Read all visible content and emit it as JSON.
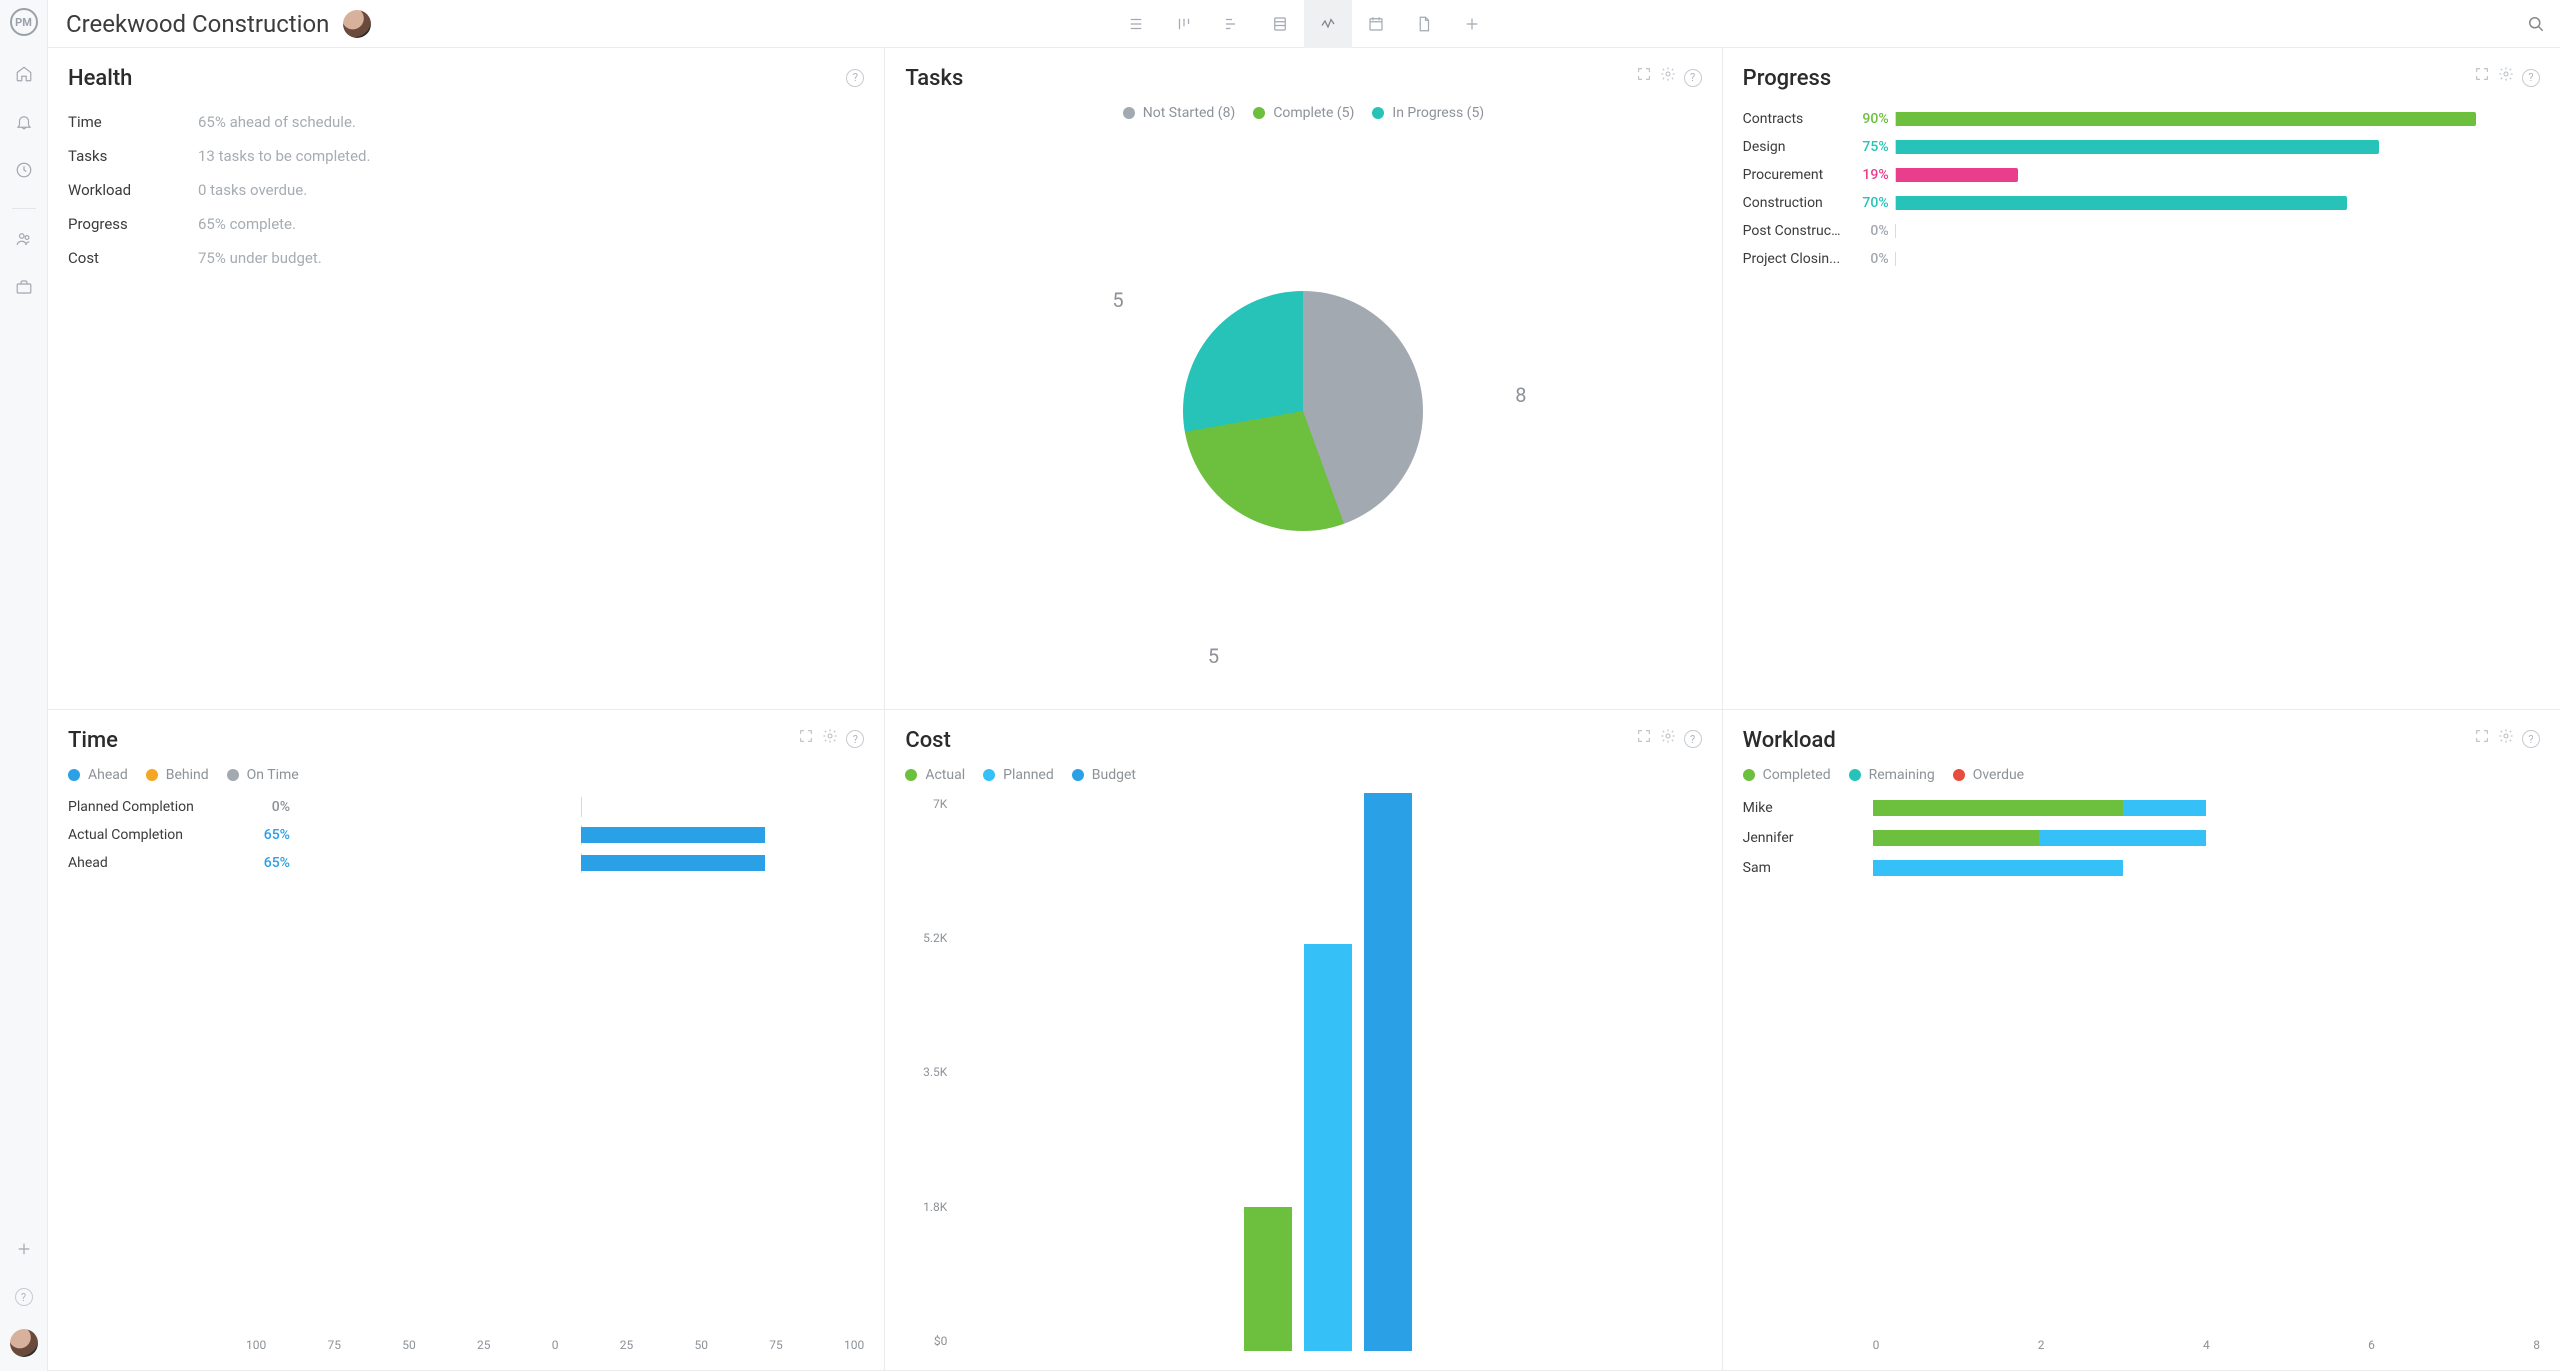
{
  "project_title": "Creekwood Construction",
  "colors": {
    "green": "#6dbf3e",
    "teal": "#27c3b8",
    "blue": "#2aa0e6",
    "lightblue": "#35c0f8",
    "grey": "#a2a9b0",
    "orange": "#f5a623",
    "pink": "#e83e8c",
    "red": "#e74c3c"
  },
  "health": {
    "title": "Health",
    "rows": [
      {
        "label": "Time",
        "value": "65% ahead of schedule."
      },
      {
        "label": "Tasks",
        "value": "13 tasks to be completed."
      },
      {
        "label": "Workload",
        "value": "0 tasks overdue."
      },
      {
        "label": "Progress",
        "value": "65% complete."
      },
      {
        "label": "Cost",
        "value": "75% under budget."
      }
    ]
  },
  "tasks": {
    "title": "Tasks",
    "legend": [
      {
        "label": "Not Started (8)",
        "color": "#a2a9b0"
      },
      {
        "label": "Complete (5)",
        "color": "#6dbf3e"
      },
      {
        "label": "In Progress (5)",
        "color": "#27c3b8"
      }
    ],
    "slices": [
      {
        "label": "8",
        "value": 8,
        "color": "#a2a9b0",
        "lab_pos": "right"
      },
      {
        "label": "5",
        "value": 5,
        "color": "#6dbf3e",
        "lab_pos": "bottom"
      },
      {
        "label": "5",
        "value": 5,
        "color": "#27c3b8",
        "lab_pos": "left"
      }
    ]
  },
  "progress": {
    "title": "Progress",
    "rows": [
      {
        "label": "Contracts",
        "pct": 90,
        "color": "#6dbf3e"
      },
      {
        "label": "Design",
        "pct": 75,
        "color": "#27c3b8"
      },
      {
        "label": "Procurement",
        "pct": 19,
        "color": "#e83e8c"
      },
      {
        "label": "Construction",
        "pct": 70,
        "color": "#27c3b8"
      },
      {
        "label": "Post Construct...",
        "pct": 0,
        "color": "#a2a9b0"
      },
      {
        "label": "Project Closin...",
        "pct": 0,
        "color": "#a2a9b0"
      }
    ]
  },
  "time": {
    "title": "Time",
    "legend": [
      {
        "label": "Ahead",
        "color": "#2aa0e6"
      },
      {
        "label": "Behind",
        "color": "#f5a623"
      },
      {
        "label": "On Time",
        "color": "#a2a9b0"
      }
    ],
    "rows": [
      {
        "label": "Planned Completion",
        "pct": 0
      },
      {
        "label": "Actual Completion",
        "pct": 65
      },
      {
        "label": "Ahead",
        "pct": 65
      }
    ],
    "axis": [
      "100",
      "75",
      "50",
      "25",
      "0",
      "25",
      "50",
      "75",
      "100"
    ]
  },
  "cost": {
    "title": "Cost",
    "legend": [
      {
        "label": "Actual",
        "color": "#6dbf3e"
      },
      {
        "label": "Planned",
        "color": "#35c0f8"
      },
      {
        "label": "Budget",
        "color": "#2aa0e6"
      }
    ],
    "yaxis": [
      "7K",
      "5.2K",
      "3.5K",
      "1.8K",
      "$0"
    ],
    "bars": [
      {
        "name": "Actual",
        "value": 1800,
        "color": "#6dbf3e"
      },
      {
        "name": "Planned",
        "value": 5100,
        "color": "#35c0f8"
      },
      {
        "name": "Budget",
        "value": 7000,
        "color": "#2aa0e6"
      }
    ],
    "ymax": 7000
  },
  "workload": {
    "title": "Workload",
    "legend": [
      {
        "label": "Completed",
        "color": "#6dbf3e"
      },
      {
        "label": "Remaining",
        "color": "#27c3b8"
      },
      {
        "label": "Overdue",
        "color": "#e74c3c"
      }
    ],
    "max": 8,
    "axis": [
      "0",
      "2",
      "4",
      "6",
      "8"
    ],
    "rows": [
      {
        "label": "Mike",
        "segments": [
          {
            "v": 3,
            "color": "#6dbf3e"
          },
          {
            "v": 1,
            "color": "#35c0f8"
          }
        ]
      },
      {
        "label": "Jennifer",
        "segments": [
          {
            "v": 2,
            "color": "#6dbf3e"
          },
          {
            "v": 2,
            "color": "#35c0f8"
          }
        ]
      },
      {
        "label": "Sam",
        "segments": [
          {
            "v": 3,
            "color": "#35c0f8"
          }
        ]
      }
    ]
  },
  "chart_data": [
    {
      "type": "pie",
      "title": "Tasks",
      "series": [
        {
          "name": "Not Started",
          "value": 8
        },
        {
          "name": "Complete",
          "value": 5
        },
        {
          "name": "In Progress",
          "value": 5
        }
      ]
    },
    {
      "type": "bar",
      "title": "Progress",
      "orientation": "horizontal",
      "categories": [
        "Contracts",
        "Design",
        "Procurement",
        "Construction",
        "Post Construction",
        "Project Closing"
      ],
      "values": [
        90,
        75,
        19,
        70,
        0,
        0
      ],
      "xlim": [
        0,
        100
      ],
      "xlabel": "%"
    },
    {
      "type": "bar",
      "title": "Time",
      "orientation": "horizontal",
      "categories": [
        "Planned Completion",
        "Actual Completion",
        "Ahead"
      ],
      "values": [
        0,
        65,
        65
      ],
      "xlim": [
        -100,
        100
      ],
      "xlabel": "%"
    },
    {
      "type": "bar",
      "title": "Cost",
      "categories": [
        "Actual",
        "Planned",
        "Budget"
      ],
      "values": [
        1800,
        5100,
        7000
      ],
      "ylim": [
        0,
        7000
      ],
      "ylabel": "$"
    },
    {
      "type": "bar",
      "title": "Workload",
      "orientation": "horizontal",
      "stacked": true,
      "categories": [
        "Mike",
        "Jennifer",
        "Sam"
      ],
      "series": [
        {
          "name": "Completed",
          "values": [
            3,
            2,
            0
          ]
        },
        {
          "name": "Remaining",
          "values": [
            1,
            2,
            3
          ]
        },
        {
          "name": "Overdue",
          "values": [
            0,
            0,
            0
          ]
        }
      ],
      "xlim": [
        0,
        8
      ]
    }
  ]
}
